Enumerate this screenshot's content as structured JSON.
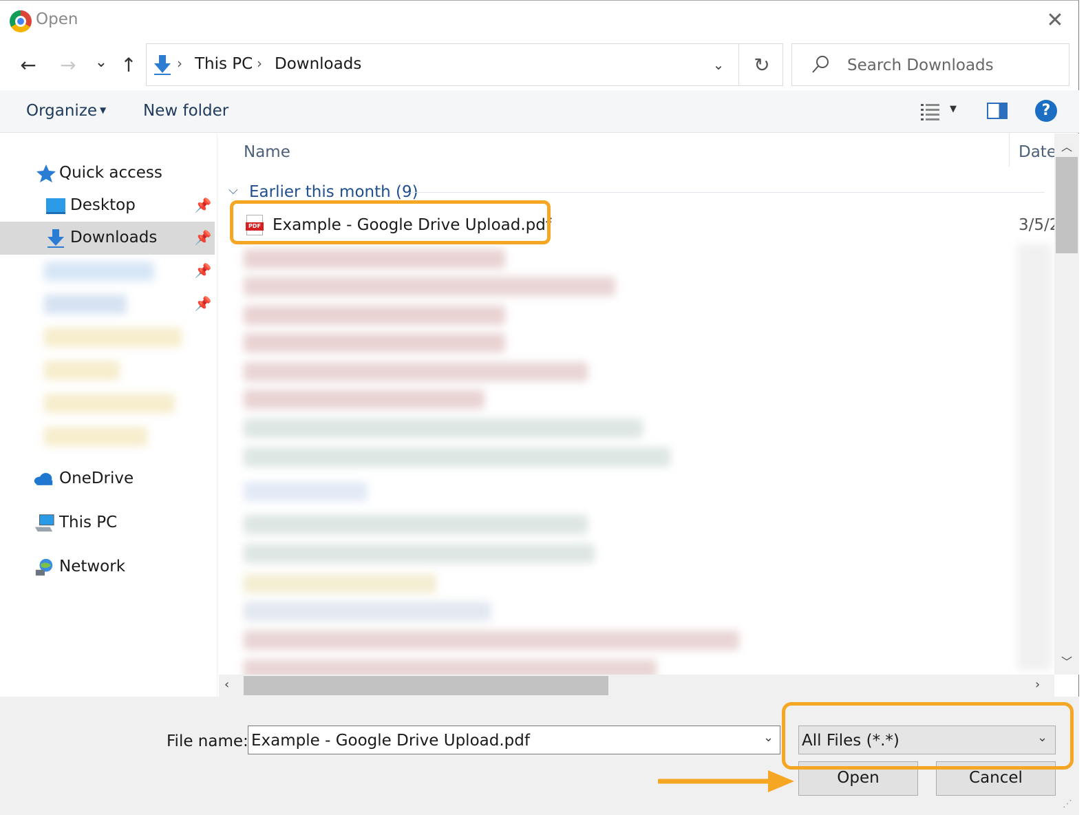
{
  "window": {
    "title": "Open",
    "close_symbol": "✕"
  },
  "nav": {
    "back_symbol": "←",
    "forward_symbol": "→",
    "recent_symbol": "⌄",
    "up_symbol": "↑",
    "breadcrumbs": [
      "This PC",
      "Downloads"
    ],
    "breadcrumb_separator": "›",
    "refresh_symbol": "↻",
    "search_placeholder": "Search Downloads"
  },
  "toolbar": {
    "organize_label": "Organize",
    "new_folder_label": "New folder",
    "help_symbol": "?"
  },
  "sidebar": {
    "quick_access_label": "Quick access",
    "items": [
      {
        "label": "Desktop",
        "icon": "desktop-icon",
        "pinned": true
      },
      {
        "label": "Downloads",
        "icon": "download-arrow-icon",
        "pinned": true,
        "selected": true
      }
    ],
    "onedrive_label": "OneDrive",
    "this_pc_label": "This PC",
    "network_label": "Network"
  },
  "filelist": {
    "columns": {
      "name": "Name",
      "date": "Date"
    },
    "group_label": "Earlier this month (9)",
    "files": [
      {
        "name": "Example - Google Drive Upload.pdf",
        "date": "3/5/2",
        "type": "pdf-icon"
      }
    ]
  },
  "bottom": {
    "file_name_label": "File name:",
    "file_name_value": "Example - Google Drive Upload.pdf",
    "file_type_value": "All Files (*.*)",
    "open_label": "Open",
    "cancel_label": "Cancel"
  },
  "colors": {
    "annotation": "#f5a623",
    "accent": "#1b6ec2",
    "selection": "#d9d9d9"
  }
}
